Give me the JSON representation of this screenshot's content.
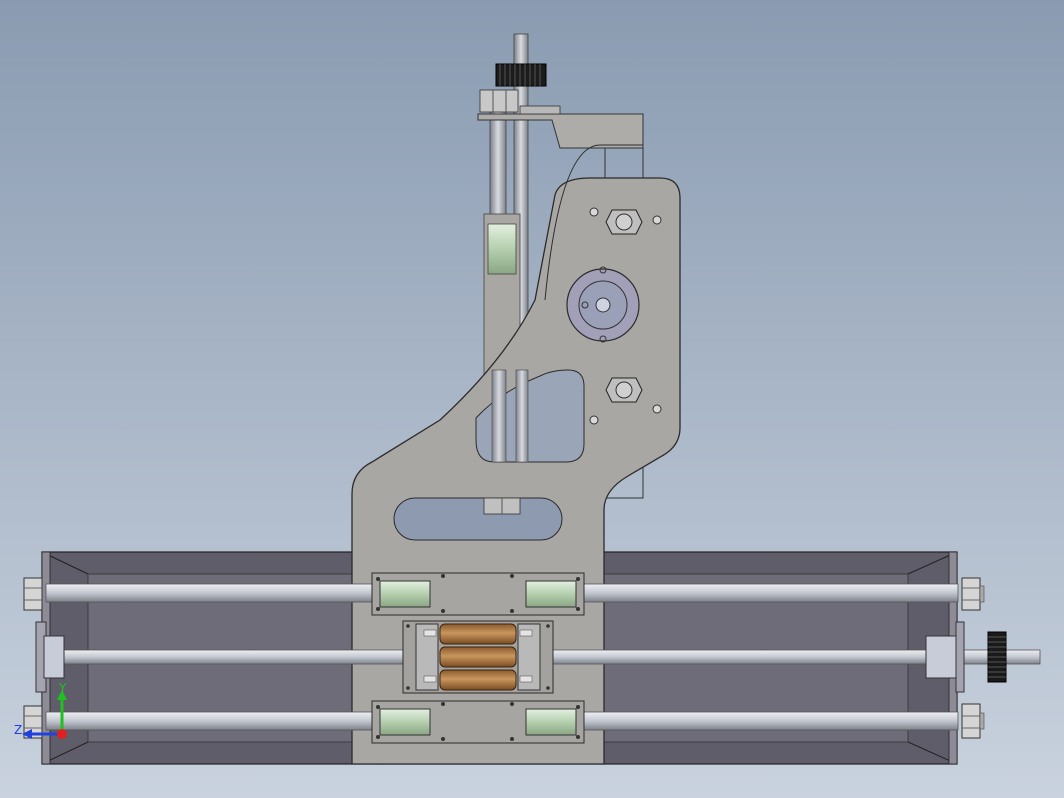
{
  "viewport": {
    "background_top": "#8a9bb1",
    "background_bottom": "#c9d2de"
  },
  "triad": {
    "y_label": "Y",
    "z_label": "Z",
    "x_color": "#e02020",
    "y_color": "#20c020",
    "z_color": "#2040e0"
  },
  "colors": {
    "plate": "#a8a6a2",
    "frame_dark": "#62606b",
    "rod": "#c9ccd3",
    "bushing": "#b9d4b2",
    "nut": "#c0c0c0",
    "bearing_block": "#b48a5a",
    "pulley": "#1a1a1a"
  }
}
